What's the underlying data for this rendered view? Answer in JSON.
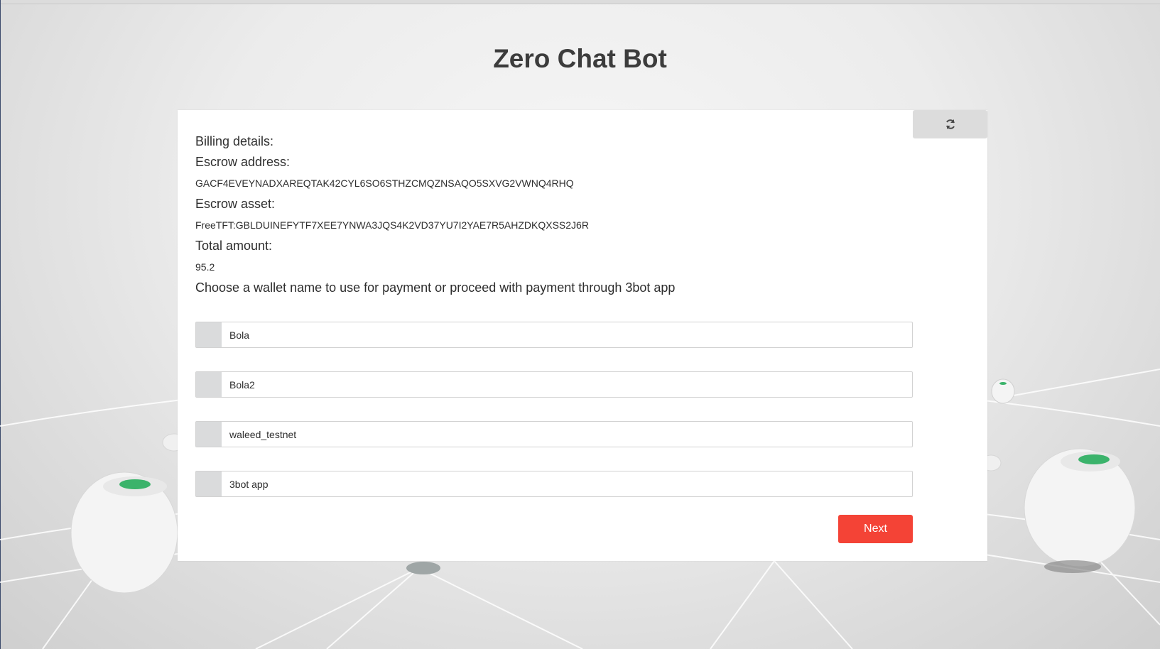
{
  "page": {
    "title": "Zero Chat Bot"
  },
  "billing": {
    "heading": "Billing details:",
    "escrow_address_label": "Escrow address:",
    "escrow_address": "GACF4EVEYNADXAREQTAK42CYL6SO6STHZCMQZNSAQO5SXVG2VWNQ4RHQ",
    "escrow_asset_label": "Escrow asset:",
    "escrow_asset": "FreeTFT:GBLDUINEFYTF7XEE7YNWA3JQS4K2VD37YU7I2YAE7R5AHZDKQXSS2J6R",
    "total_amount_label": "Total amount:",
    "total_amount": "95.2",
    "prompt": "Choose a wallet name to use for payment or proceed with payment through 3bot app"
  },
  "wallets": {
    "options": [
      {
        "label": "Bola"
      },
      {
        "label": "Bola2"
      },
      {
        "label": "waleed_testnet"
      },
      {
        "label": "3bot app"
      }
    ]
  },
  "actions": {
    "next_label": "Next",
    "refresh_icon": "refresh-icon"
  },
  "colors": {
    "accent": "#f44336",
    "radio_bg": "#dadbdc",
    "refresh_bg": "#dcdcdc"
  }
}
